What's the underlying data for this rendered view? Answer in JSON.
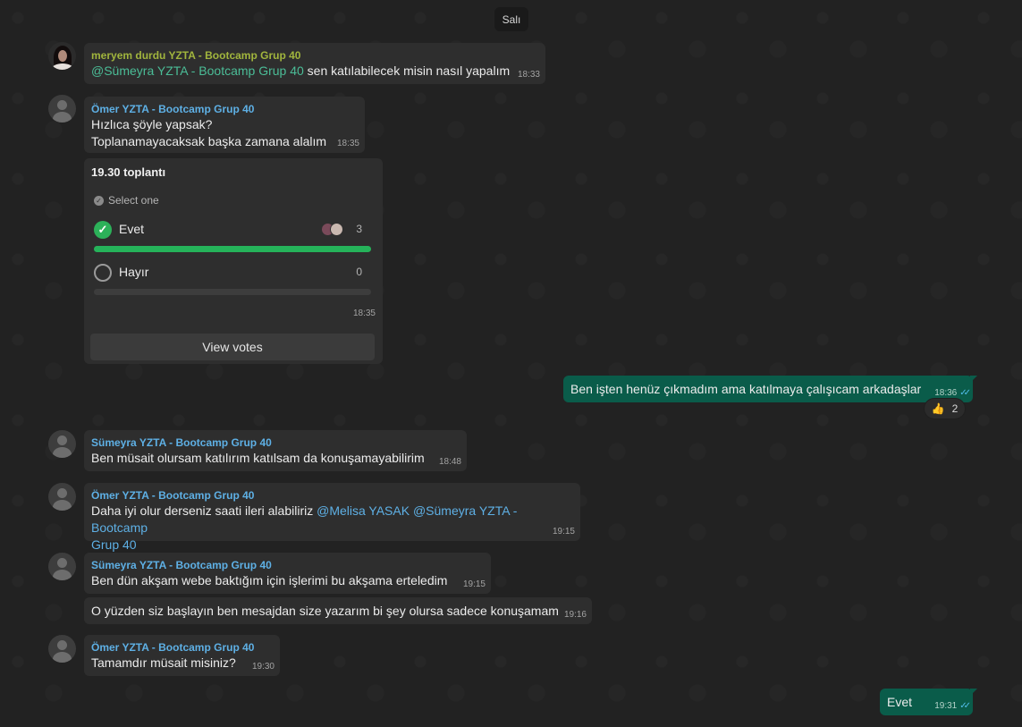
{
  "date_separator": "Salı",
  "messages": [
    {
      "sender": "meryem durdu YZTA - Bootcamp Grup 40",
      "mention": "@Sümeyra YZTA - Bootcamp Grup 40",
      "text": " sen katılabilecek misin nasıl yapalım",
      "time": "18:33"
    },
    {
      "sender": "Ömer YZTA - Bootcamp Grup 40",
      "line1": "Hızlıca şöyle yapsak?",
      "line2": "Toplanamayacaksak başka zamana alalım",
      "time": "18:35"
    },
    {
      "sender": "Sümeyra YZTA - Bootcamp Grup 40",
      "text": "Ben müsait olursam katılırım katılsam da konuşamayabilirim",
      "time": "18:48"
    },
    {
      "sender": "Ömer YZTA - Bootcamp Grup 40",
      "text": "Daha iyi olur derseniz saati ileri alabiliriz ",
      "mention1": "@Melisa YASAK",
      "mention2": " @Sümeyra YZTA - Bootcamp",
      "line2": "Grup 40",
      "time": "19:15"
    },
    {
      "sender": "Sümeyra YZTA - Bootcamp Grup 40",
      "text": "Ben dün akşam webe baktığım için işlerimi bu akşama erteledim",
      "time": "19:15"
    },
    {
      "text": "O yüzden siz başlayın ben mesajdan size yazarım bi şey olursa sadece konuşamam",
      "time": "19:16"
    },
    {
      "sender": "Ömer YZTA - Bootcamp Grup 40",
      "text": "Tamamdır müsait misiniz?",
      "time": "19:30"
    }
  ],
  "poll": {
    "question": "19.30 toplantı",
    "instruction": "Select one",
    "options": [
      {
        "label": "Evet",
        "votes": "3",
        "fraction": 1.0,
        "selected": true
      },
      {
        "label": "Hayır",
        "votes": "0",
        "fraction": 0.0,
        "selected": false
      }
    ],
    "time": "18:35",
    "view_votes": "View votes"
  },
  "outgoing": [
    {
      "text": "Ben işten henüz çıkmadım ama katılmaya çalışıcam arkadaşlar",
      "time": "18:36",
      "reaction_count": "2"
    },
    {
      "text": "Evet",
      "time": "19:31"
    }
  ],
  "colors": {
    "outgoing_bubble": "#0a5c4a",
    "incoming_bubble": "#2e2e2e",
    "poll_bar": "#25b35a",
    "sender_green": "#a1b53d",
    "sender_blue": "#5eb0e5"
  }
}
